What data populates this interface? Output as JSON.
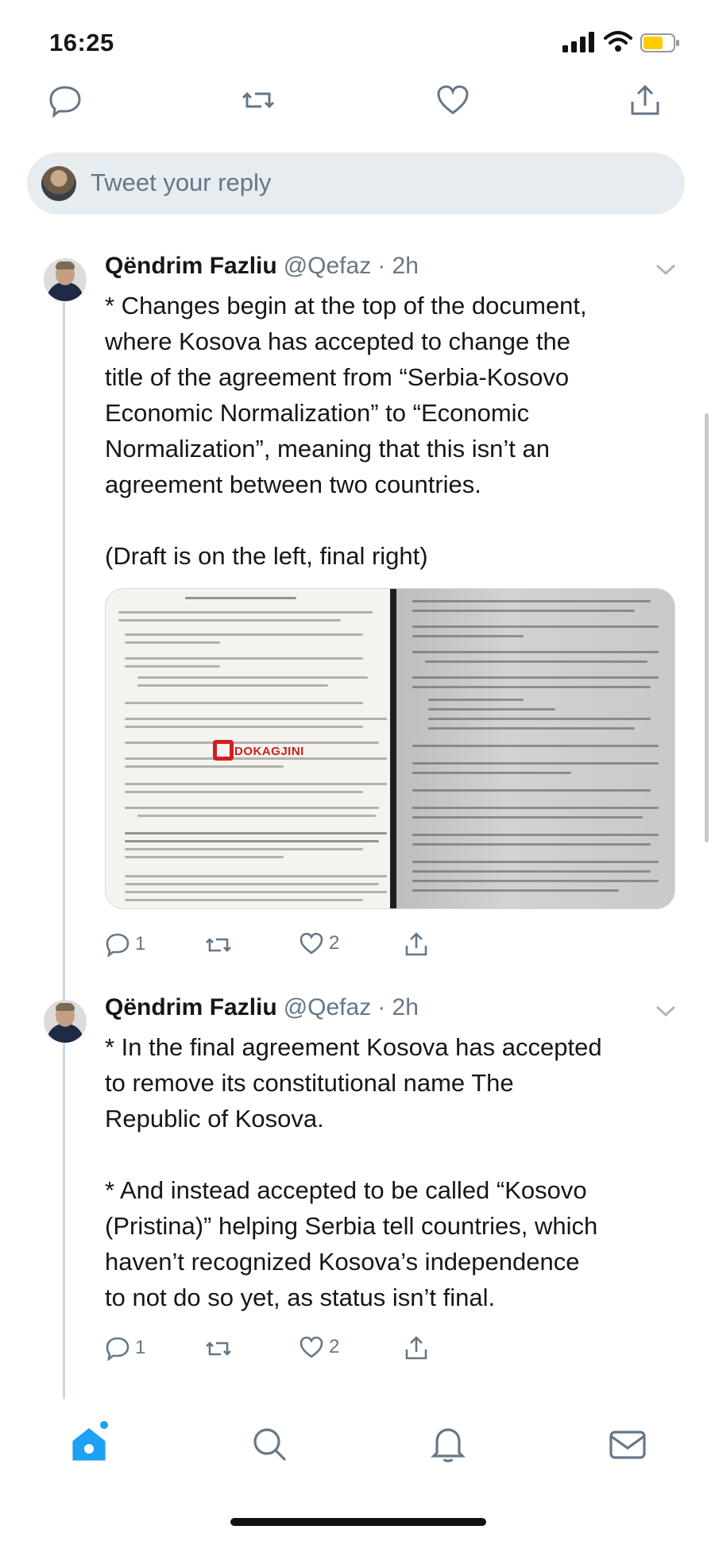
{
  "status_bar": {
    "time": "16:25"
  },
  "reply": {
    "placeholder": "Tweet your reply"
  },
  "tweets": [
    {
      "name": "Qëndrim Fazliu",
      "handle": "@Qefaz",
      "time": "· 2h",
      "text": "* Changes begin at the top of the document,\nwhere Kosova has accepted to change the\ntitle of the agreement from “Serbia-Kosovo\nEconomic Normalization” to “Economic\nNormalization”, meaning that this isn’t an\nagreement between two countries.\n\n(Draft is on the left, final right)",
      "media": {
        "watermark": "DOKAGJINI"
      },
      "replies": "1",
      "likes": "2"
    },
    {
      "name": "Qëndrim Fazliu",
      "handle": "@Qefaz",
      "time": "· 2h",
      "text": "* In the final agreement Kosova has accepted\nto remove its constitutional name The\nRepublic of Kosova.\n\n* And instead accepted to be called “Kosovo\n(Pristina)” helping Serbia tell countries, which\nhaven’t recognized Kosova’s independence\nto not do so yet, as status isn’t final.",
      "replies": "1",
      "likes": "2"
    }
  ],
  "colors": {
    "accent": "#1da1f2",
    "icon_gray": "#657786",
    "battery": "#ffcc00"
  }
}
